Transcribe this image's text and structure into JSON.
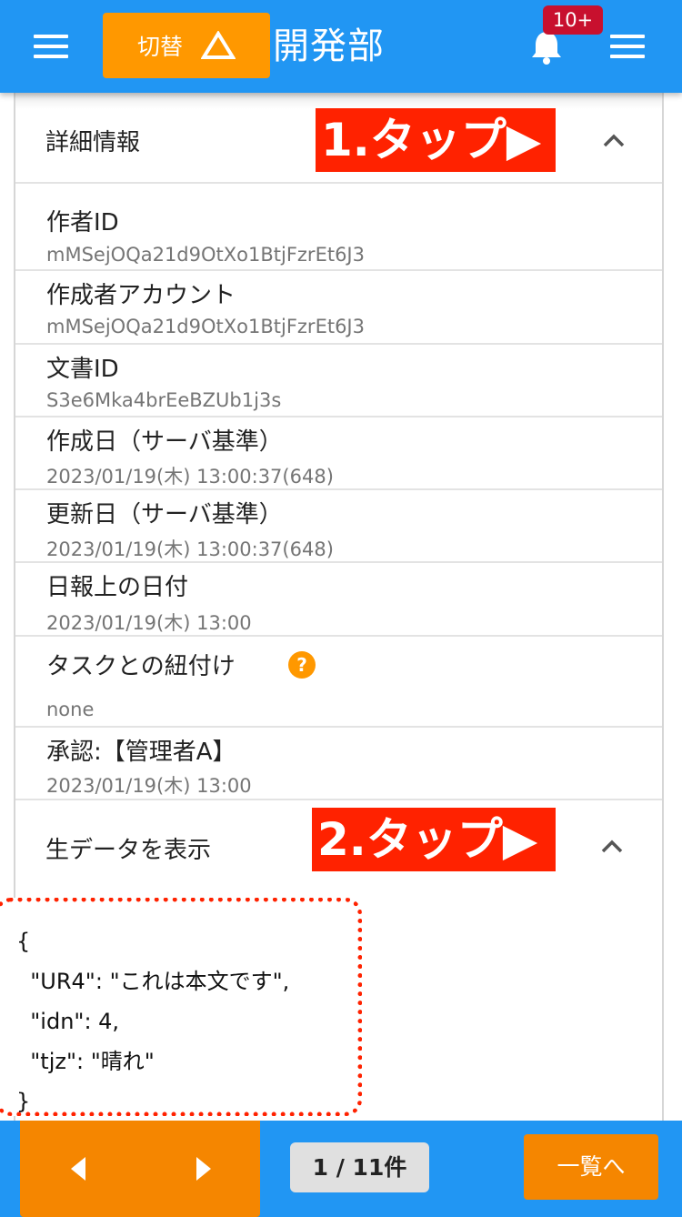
{
  "header": {
    "switch_label": "切替",
    "title": "開発部",
    "notification_badge": "10+"
  },
  "details_section": {
    "title": "詳細情報",
    "tap_annotation": "1.タップ▶",
    "rows": [
      {
        "label": "作者ID",
        "value": "mMSejOQa21d9OtXo1BtjFzrEt6J3"
      },
      {
        "label": "作成者アカウント",
        "value": "mMSejOQa21d9OtXo1BtjFzrEt6J3"
      },
      {
        "label": "文書ID",
        "value": "S3e6Mka4brEeBZUb1j3s"
      },
      {
        "label": "作成日（サーバ基準）",
        "value": "2023/01/19(木) 13:00:37(648)"
      },
      {
        "label": "更新日（サーバ基準）",
        "value": "2023/01/19(木) 13:00:37(648)"
      },
      {
        "label": "日報上の日付",
        "value": "2023/01/19(木) 13:00"
      },
      {
        "label": "タスクとの紐付け",
        "value": "none",
        "help_icon": "?"
      },
      {
        "label": "承認:【管理者A】",
        "value": "2023/01/19(木) 13:00"
      }
    ]
  },
  "raw_section": {
    "title": "生データを表示",
    "tap_annotation": "2.タップ▶",
    "raw_text": "{\n  \"UR4\": \"これは本文です\",\n  \"idn\": 4,\n  \"tjz\": \"晴れ\"\n}"
  },
  "footer": {
    "page_counter": "1 / 11件",
    "list_button": "一覧へ"
  }
}
